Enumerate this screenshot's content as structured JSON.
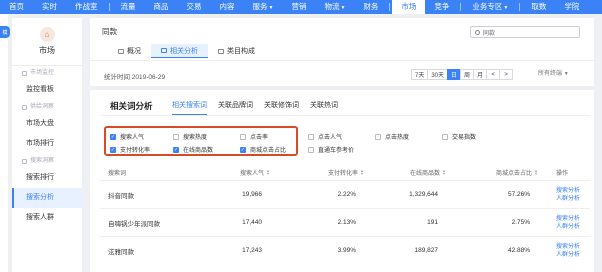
{
  "topnav": {
    "items": [
      "首页",
      "实时",
      "作战室",
      "流量",
      "商品",
      "交易",
      "内容",
      "服务",
      "营销",
      "物流",
      "财务",
      "市场",
      "竞争",
      "业务专区",
      "取数",
      "学院"
    ],
    "active_index": 11
  },
  "left_badge": "模",
  "sidebar": {
    "title": "市场",
    "groups": [
      {
        "label": "市场监控",
        "items": [
          "监控看板"
        ]
      },
      {
        "label": "供给洞察",
        "items": [
          "市场大盘",
          "市场排行"
        ]
      },
      {
        "label": "搜索洞察",
        "items": [
          "搜索排行",
          "搜索分析",
          "搜索人群"
        ]
      }
    ],
    "active_item": "搜索分析"
  },
  "header": {
    "page_title": "同款",
    "search_value": "同款",
    "tabs": [
      "概况",
      "相关分析",
      "类目构成"
    ],
    "active_tab": 1,
    "stat_time": "统计时间 2019-06-29",
    "date_buttons": [
      "7天",
      "30天",
      "日",
      "周",
      "月",
      "<",
      ">"
    ],
    "active_date": "日",
    "terminal": "所有终端"
  },
  "section": {
    "title": "相关词分析",
    "tabs": [
      "相关搜索词",
      "关联品牌词",
      "关联修饰词",
      "关联热词"
    ],
    "active_tab": 0
  },
  "checkboxes": [
    {
      "label": "搜索人气",
      "checked": true
    },
    {
      "label": "搜索热度",
      "checked": false
    },
    {
      "label": "点击率",
      "checked": false
    },
    {
      "label": "点击人气",
      "checked": false
    },
    {
      "label": "点击热度",
      "checked": false
    },
    {
      "label": "交易指数",
      "checked": false
    },
    {
      "label": "支付转化率",
      "checked": true
    },
    {
      "label": "在线商品数",
      "checked": true
    },
    {
      "label": "商城点击占比",
      "checked": true
    },
    {
      "label": "直通车参考价",
      "checked": false
    }
  ],
  "table": {
    "headers": [
      "搜索词",
      "搜索人气",
      "支付转化率",
      "在线商品数",
      "商城点击占比",
      "操作"
    ],
    "rows": [
      {
        "word": "抖音同款",
        "popularity": "19,966",
        "conversion": "2.22%",
        "online": "1,329,644",
        "mall_ratio": "57.26%"
      },
      {
        "word": "自嗨锅少年派同款",
        "popularity": "17,440",
        "conversion": "2.13%",
        "online": "191",
        "mall_ratio": "2.75%"
      },
      {
        "word": "泫雅同款",
        "popularity": "17,243",
        "conversion": "3.99%",
        "online": "189,827",
        "mall_ratio": "42.88%"
      }
    ],
    "actions": [
      "搜索分析",
      "人群分析"
    ]
  }
}
